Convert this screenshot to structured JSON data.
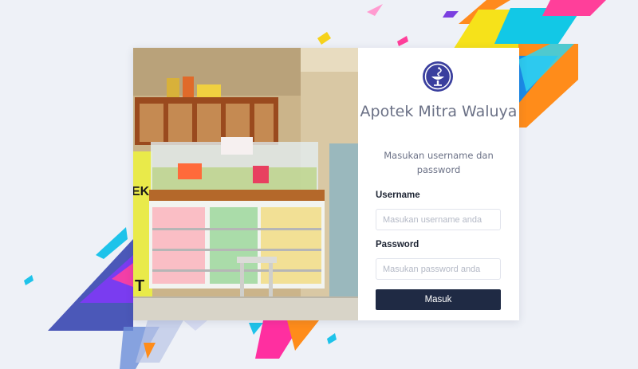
{
  "app": {
    "title": "Apotek Mitra Waluya",
    "subtitle": "Masukan username dan password"
  },
  "form": {
    "username_label": "Username",
    "username_placeholder": "Masukan username anda",
    "password_label": "Password",
    "password_placeholder": "Masukan password anda",
    "submit_label": "Masuk"
  },
  "colors": {
    "background": "#eef1f7",
    "button": "#1f2a44",
    "logo": "#3a3f9e",
    "text_muted": "#6b7186"
  },
  "icons": {
    "logo": "pharmacy-bowl-of-hygieia-icon"
  }
}
